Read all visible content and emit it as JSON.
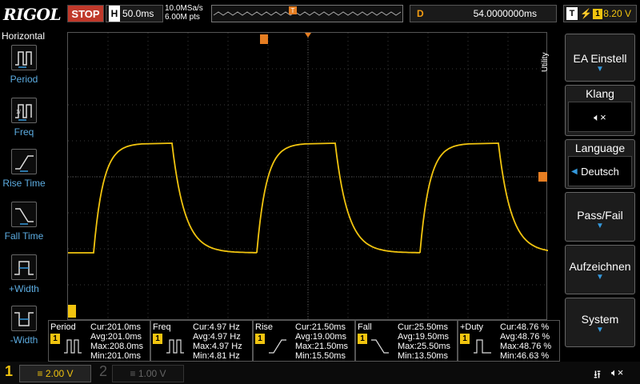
{
  "brand": "RIGOL",
  "run_state": "STOP",
  "horizontal": {
    "h_label": "H",
    "timebase": "50.0ms",
    "sample_rate": "10.0MSa/s",
    "mem_depth": "6.00M pts"
  },
  "delay": {
    "d_label": "D",
    "value": "54.0000000ms"
  },
  "trigger": {
    "t_label": "T",
    "source_badge": "1",
    "level": "8.20 V",
    "edge_symbol": "⚡"
  },
  "left_menu": {
    "header": "Horizontal",
    "items": [
      {
        "label": "Period"
      },
      {
        "label": "Freq"
      },
      {
        "label": "Rise Time"
      },
      {
        "label": "Fall Time"
      },
      {
        "label": "+Width"
      },
      {
        "label": "-Width"
      }
    ]
  },
  "right_menu": {
    "utility_label": "Utility",
    "items": [
      {
        "label": "EA Einstell"
      },
      {
        "label": "Klang"
      },
      {
        "label": "Language",
        "value": "Deutsch"
      },
      {
        "label": "Pass/Fail"
      },
      {
        "label": "Aufzeichnen"
      },
      {
        "label": "System"
      }
    ]
  },
  "measurements": [
    {
      "title": "Period",
      "channel": "1",
      "cur": "Cur:201.0ms",
      "avg": "Avg:201.0ms",
      "max": "Max:208.0ms",
      "min": "Min:201.0ms"
    },
    {
      "title": "Freq",
      "channel": "1",
      "cur": "Cur:4.97 Hz",
      "avg": "Avg:4.97 Hz",
      "max": "Max:4.97 Hz",
      "min": "Min:4.81 Hz"
    },
    {
      "title": "Rise",
      "channel": "1",
      "cur": "Cur:21.50ms",
      "avg": "Avg:19.00ms",
      "max": "Max:21.50ms",
      "min": "Min:15.50ms"
    },
    {
      "title": "Fall",
      "channel": "1",
      "cur": "Cur:25.50ms",
      "avg": "Avg:19.50ms",
      "max": "Max:25.50ms",
      "min": "Min:13.50ms"
    },
    {
      "title": "+Duty",
      "channel": "1",
      "cur": "Cur:48.76 %",
      "avg": "Avg:48.76 %",
      "max": "Max:48.76 %",
      "min": "Min:46.63 %"
    }
  ],
  "channels": {
    "ch1": {
      "number": "1",
      "scale": "2.00 V",
      "color": "#f1c40f"
    },
    "ch2": {
      "number": "2",
      "scale": "1.00 V",
      "color": "#555555"
    }
  },
  "marker_t": "T",
  "icons": {
    "usb": "usb-icon",
    "speaker": "speaker-mute-icon"
  }
}
